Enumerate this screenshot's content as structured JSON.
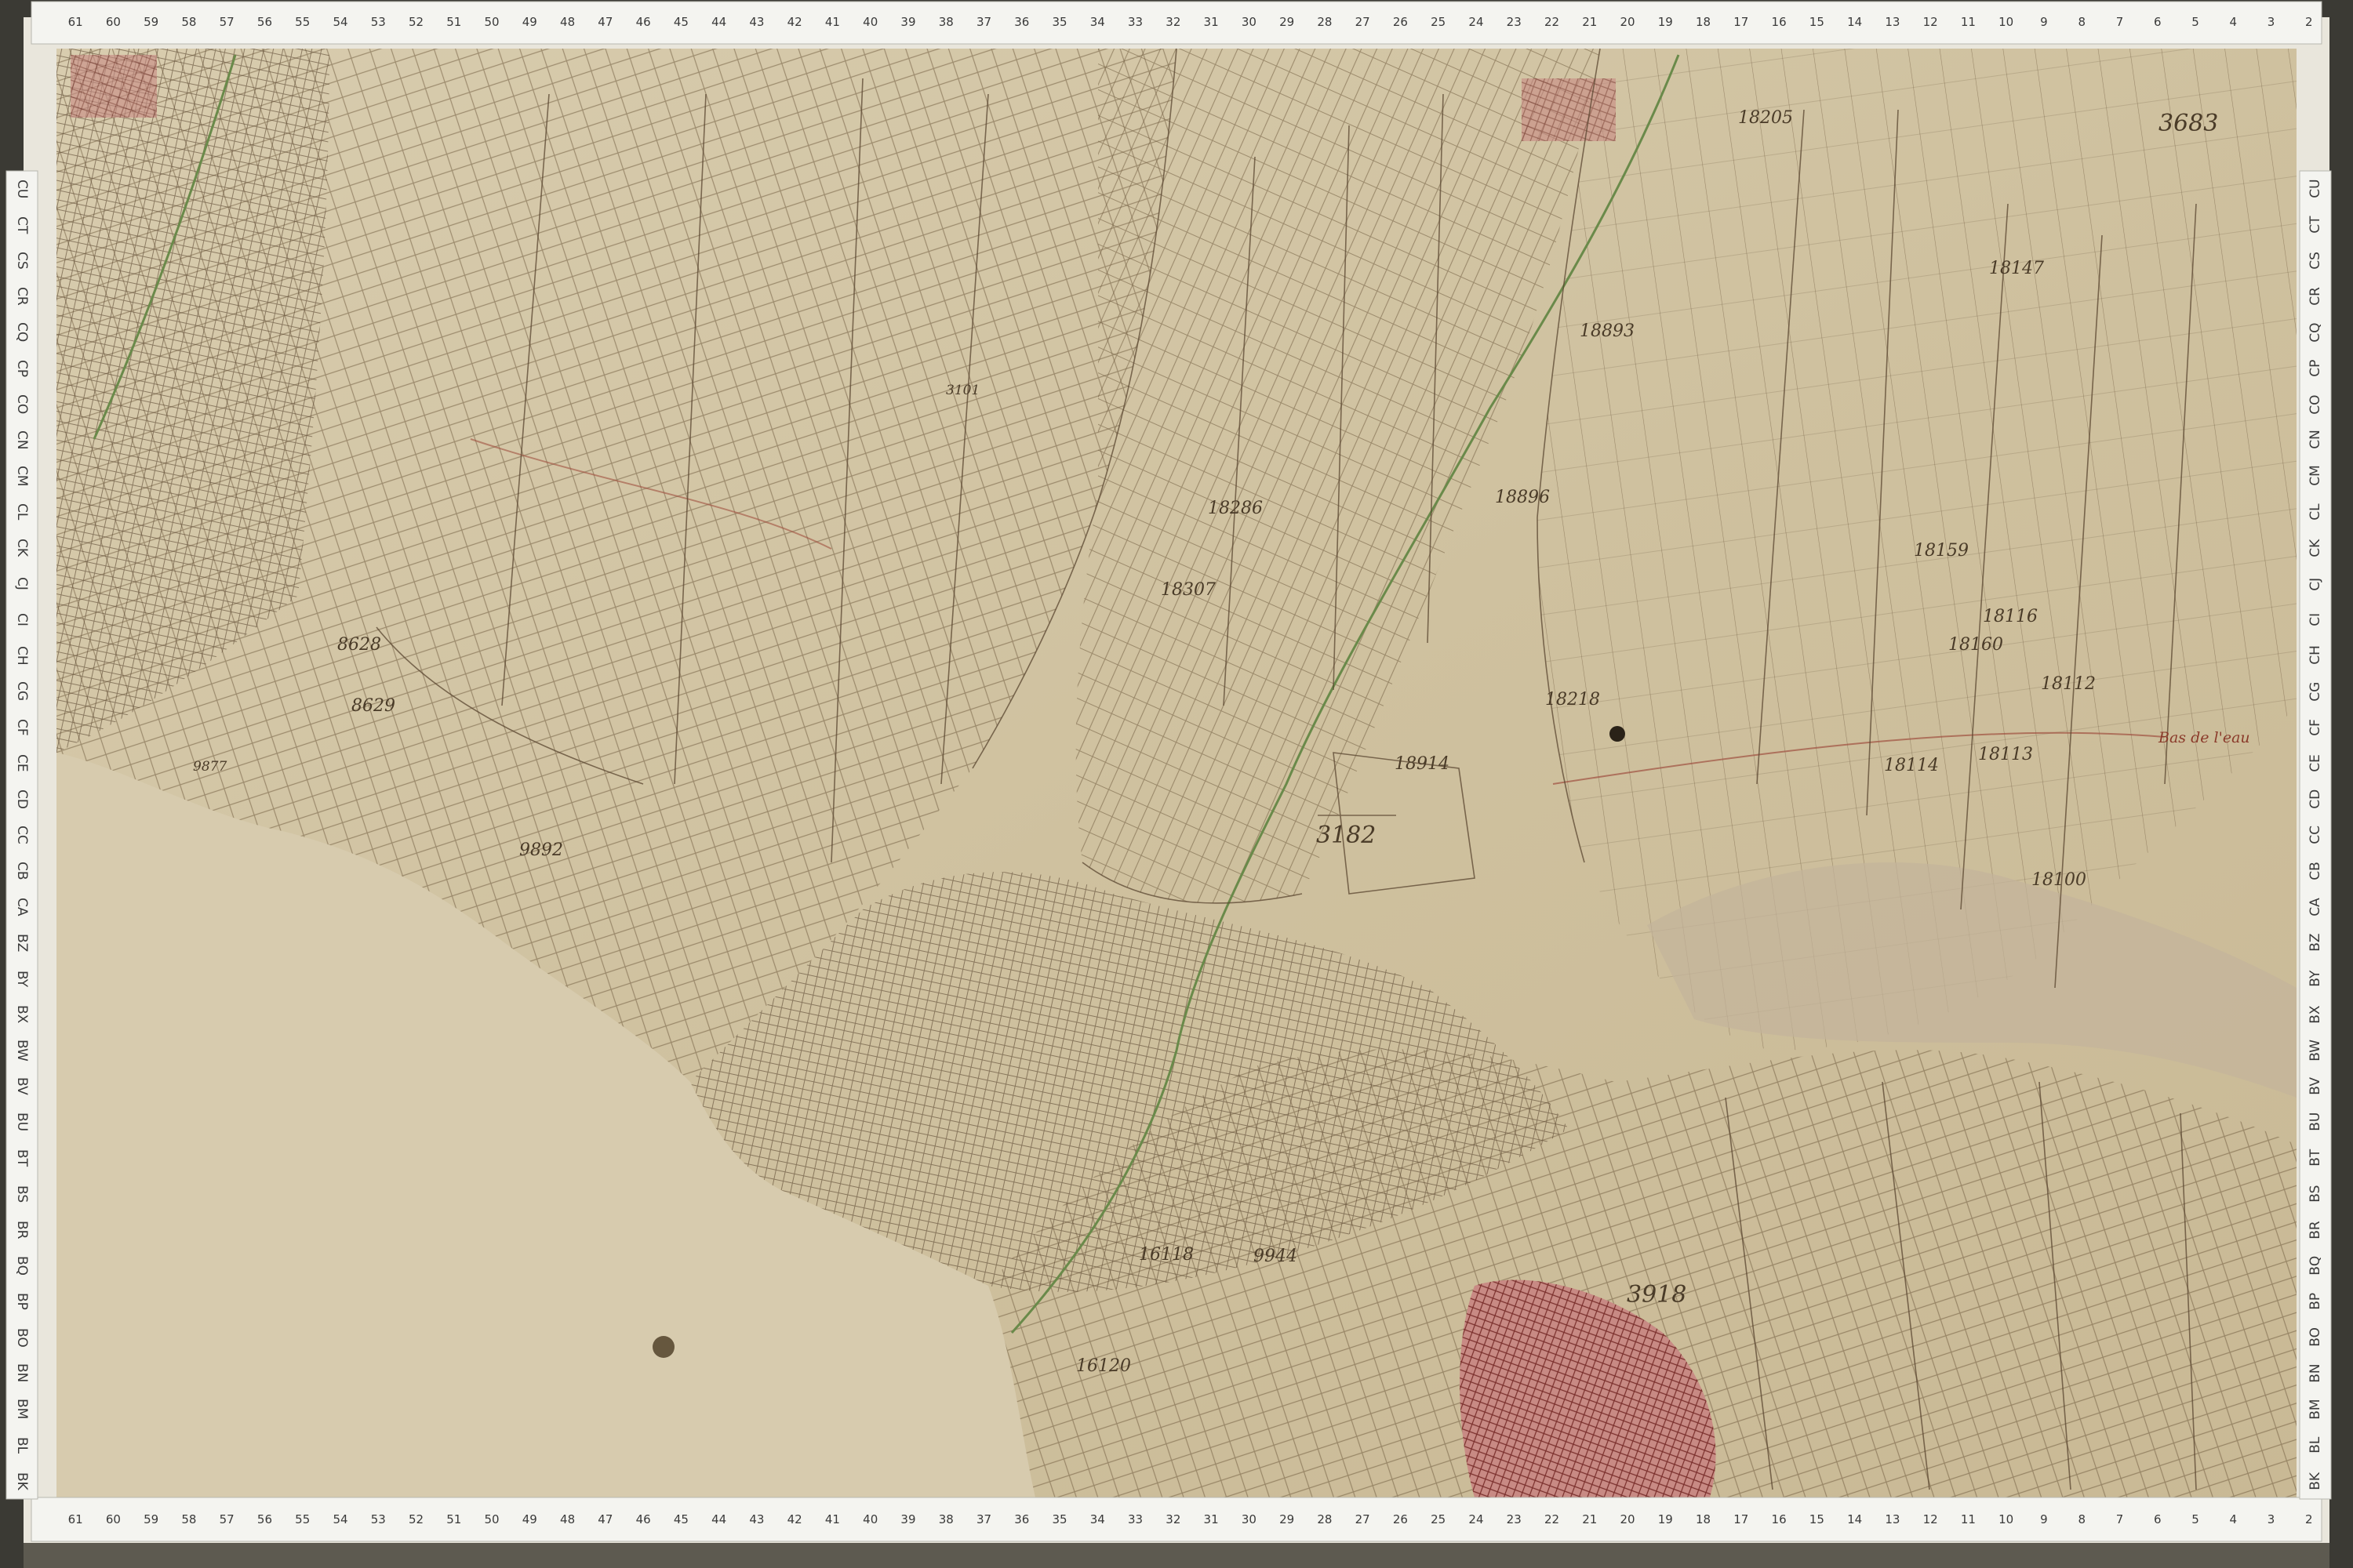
{
  "document": {
    "type": "cadastral-map-scan"
  },
  "rulers": {
    "top": [
      "61",
      "60",
      "59",
      "58",
      "57",
      "56",
      "55",
      "54",
      "53",
      "52",
      "51",
      "50",
      "49",
      "48",
      "47",
      "46",
      "45",
      "44",
      "43",
      "42",
      "41",
      "40",
      "39",
      "38",
      "37",
      "36",
      "35",
      "34",
      "33",
      "32",
      "31",
      "30",
      "29",
      "28",
      "27",
      "26",
      "25",
      "24",
      "23",
      "22",
      "21",
      "20",
      "19",
      "18",
      "17",
      "16",
      "15",
      "14",
      "13",
      "12",
      "11",
      "10",
      "9",
      "8",
      "7",
      "6",
      "5",
      "4",
      "3",
      "2"
    ],
    "bottom": [
      "61",
      "60",
      "59",
      "58",
      "57",
      "56",
      "55",
      "54",
      "53",
      "52",
      "51",
      "50",
      "49",
      "48",
      "47",
      "46",
      "45",
      "44",
      "43",
      "42",
      "41",
      "40",
      "39",
      "38",
      "37",
      "36",
      "35",
      "34",
      "33",
      "32",
      "31",
      "30",
      "29",
      "28",
      "27",
      "26",
      "25",
      "24",
      "23",
      "22",
      "21",
      "20",
      "19",
      "18",
      "17",
      "16",
      "15",
      "14",
      "13",
      "12",
      "11",
      "10",
      "9",
      "8",
      "7",
      "6",
      "5",
      "4",
      "3",
      "2"
    ],
    "left": [
      "CU",
      "CT",
      "CS",
      "CR",
      "CQ",
      "CP",
      "CO",
      "CN",
      "CM",
      "CL",
      "CK",
      "CJ",
      "CI",
      "CH",
      "CG",
      "CF",
      "CE",
      "CD",
      "CC",
      "CB",
      "CA",
      "BZ",
      "BY",
      "BX",
      "BW",
      "BV",
      "BU",
      "BT",
      "BS",
      "BR",
      "BQ",
      "BP",
      "BO",
      "BN",
      "BM",
      "BL",
      "BK"
    ],
    "right": [
      "CU",
      "CT",
      "CS",
      "CR",
      "CQ",
      "CP",
      "CO",
      "CN",
      "CM",
      "CL",
      "CK",
      "CJ",
      "CI",
      "CH",
      "CG",
      "CF",
      "CE",
      "CD",
      "CC",
      "CB",
      "CA",
      "BZ",
      "BY",
      "BX",
      "BW",
      "BV",
      "BU",
      "BT",
      "BS",
      "BR",
      "BQ",
      "BP",
      "BO",
      "BN",
      "BM",
      "BL",
      "BK"
    ]
  },
  "parcels": {
    "p3182": "3182",
    "p3918": "3918",
    "p18160": "18160",
    "p18159": "18159",
    "p18147": "18147",
    "p18896": "18896",
    "p18893": "18893",
    "p18286": "18286",
    "p18307": "18307",
    "p18914": "18914",
    "p3683": "3683",
    "p16120": "16120",
    "p9892": "9892",
    "p8629": "8629",
    "p8628": "8628",
    "p18114": "18114",
    "p18113": "18113",
    "p18112": "18112",
    "p18100": "18100",
    "p18116": "18116",
    "p18218": "18218",
    "p18205": "18205",
    "p3101": "3101",
    "p9877": "9877",
    "p16118": "16118",
    "p9944": "9944"
  },
  "annotation": {
    "bassin": "Bas de l'eau"
  }
}
